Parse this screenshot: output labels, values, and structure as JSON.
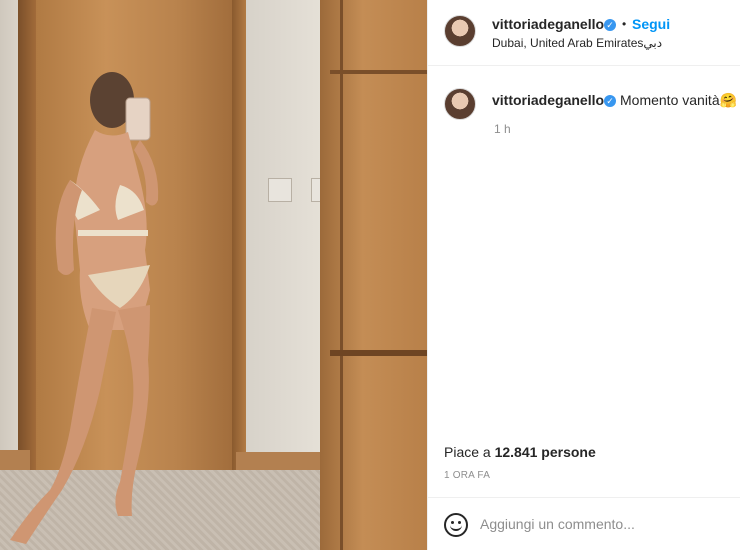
{
  "post": {
    "author": "vittoriadeganello",
    "follow_label": "Segui",
    "separator": "•",
    "location": "Dubai, United Arab Emiratesدبي"
  },
  "caption": {
    "author": "vittoriadeganello",
    "text": "Momento vanità",
    "emoji": "🤗",
    "age": "1 h"
  },
  "stats": {
    "likes_prefix": "Piace a ",
    "likes_count": "12.841 persone",
    "time_ago": "1 ORA FA"
  },
  "comment_box": {
    "placeholder": "Aggiungi un commento..."
  },
  "icons": {
    "verified": "verified-badge-icon",
    "emoji": "emoji-icon"
  },
  "colors": {
    "accent": "#0095f6",
    "verified": "#3897f0",
    "muted": "#8e8e8e"
  }
}
